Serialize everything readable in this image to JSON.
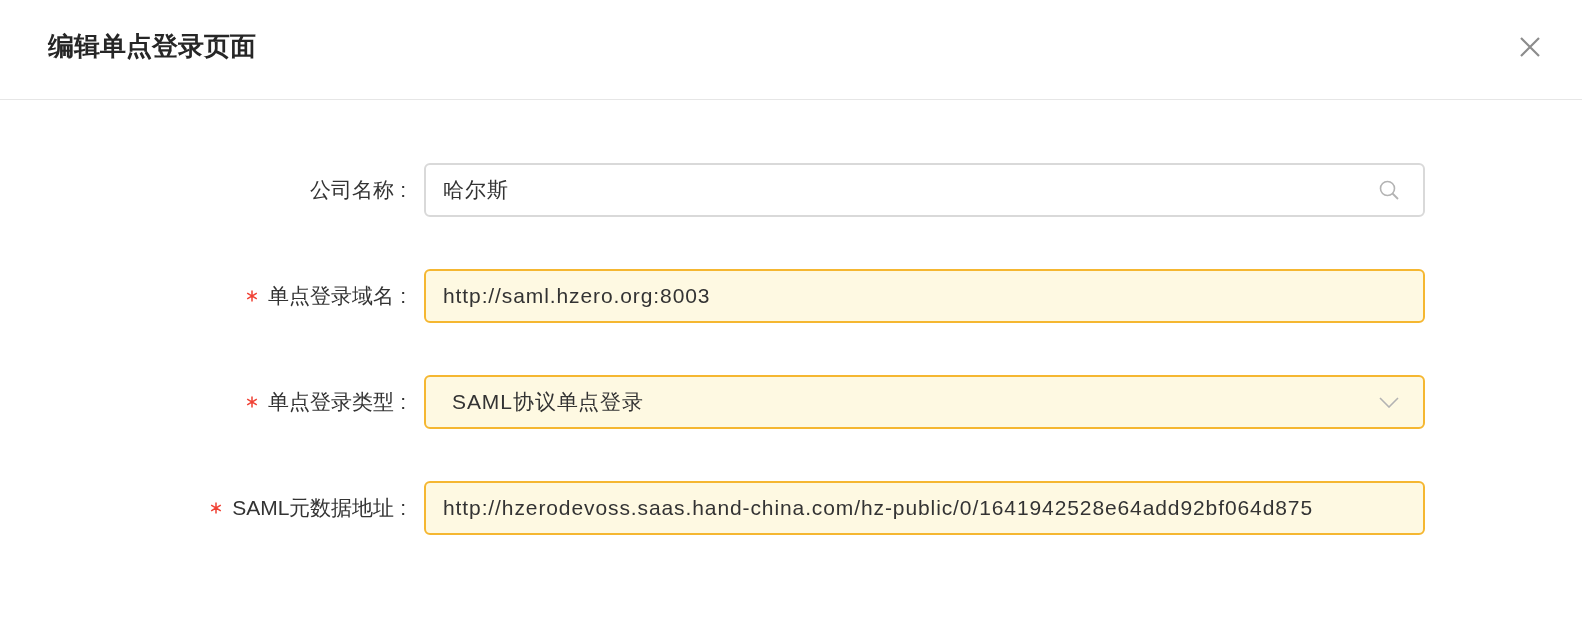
{
  "dialog": {
    "title": "编辑单点登录页面"
  },
  "form": {
    "fields": [
      {
        "label": "公司名称 :",
        "required": false,
        "kind": "lookup",
        "value": "哈尔斯"
      },
      {
        "label": "单点登录域名 :",
        "required": true,
        "kind": "text",
        "value": "http://saml.hzero.org:8003"
      },
      {
        "label": "单点登录类型 :",
        "required": true,
        "kind": "select",
        "value": "SAML协议单点登录"
      },
      {
        "label": "SAML元数据地址 :",
        "required": true,
        "kind": "text",
        "value": "http://hzerodevoss.saas.hand-china.com/hz-public/0/1641942528e64add92bf064d875"
      }
    ]
  }
}
